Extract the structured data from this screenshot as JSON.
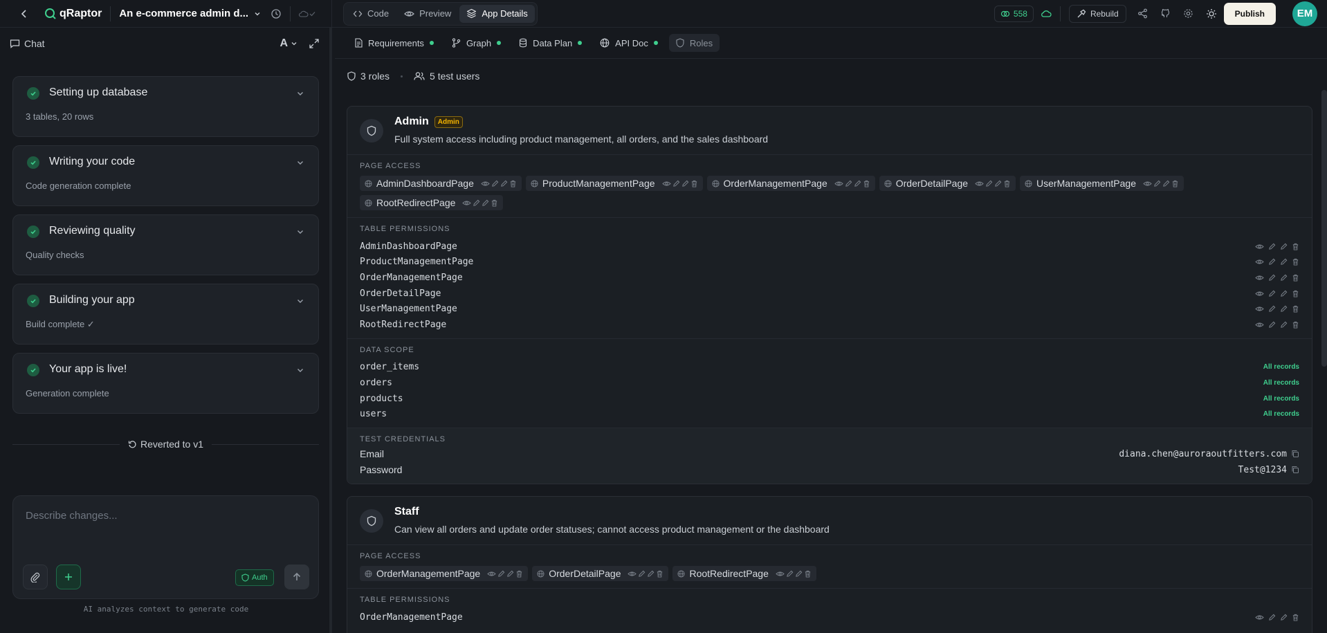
{
  "app": {
    "brand": "qRaptor",
    "project_title": "An e-commerce admin d..."
  },
  "view_tabs": [
    {
      "label": "Code",
      "icon": "code-icon"
    },
    {
      "label": "Preview",
      "icon": "eye-icon"
    },
    {
      "label": "App Details",
      "icon": "layers-icon",
      "active": true
    }
  ],
  "toolbar": {
    "credits": "558",
    "rebuild_label": "Rebuild",
    "publish_label": "Publish",
    "avatar_initials": "EM"
  },
  "chat": {
    "header_label": "Chat",
    "font_label": "A",
    "steps": [
      {
        "title": "Setting up database",
        "subtitle": "3 tables, 20 rows"
      },
      {
        "title": "Writing your code",
        "subtitle": "Code generation complete"
      },
      {
        "title": "Reviewing quality",
        "subtitle": "Quality checks"
      },
      {
        "title": "Building your app",
        "subtitle": "Build complete ✓"
      },
      {
        "title": "Your app is live!",
        "subtitle": "Generation complete"
      }
    ],
    "reverted_label": "Reverted to v1",
    "composer_placeholder": "Describe changes...",
    "auth_label": "Auth",
    "footnote": "AI analyzes context to generate code"
  },
  "details_tabs": [
    {
      "label": "Requirements",
      "icon": "file-icon",
      "dot": true
    },
    {
      "label": "Graph",
      "icon": "branch-icon",
      "dot": true
    },
    {
      "label": "Data Plan",
      "icon": "database-icon",
      "dot": true
    },
    {
      "label": "API Doc",
      "icon": "globe-icon",
      "dot": true
    },
    {
      "label": "Roles",
      "icon": "shield-icon",
      "dot": false,
      "active": true
    }
  ],
  "summary": {
    "roles": "3 roles",
    "users": "5 test users"
  },
  "labels": {
    "page_access": "PAGE ACCESS",
    "table_permissions": "TABLE PERMISSIONS",
    "data_scope": "DATA SCOPE",
    "test_credentials": "TEST CREDENTIALS",
    "email": "Email",
    "password": "Password"
  },
  "roles": [
    {
      "name": "Admin",
      "badge": "Admin",
      "description": "Full system access including product management, all orders, and the sales dashboard",
      "page_access": [
        "AdminDashboardPage",
        "ProductManagementPage",
        "OrderManagementPage",
        "OrderDetailPage",
        "UserManagementPage",
        "RootRedirectPage"
      ],
      "table_permissions": [
        "AdminDashboardPage",
        "ProductManagementPage",
        "OrderManagementPage",
        "OrderDetailPage",
        "UserManagementPage",
        "RootRedirectPage"
      ],
      "data_scope": [
        {
          "table": "order_items",
          "scope": "All records"
        },
        {
          "table": "orders",
          "scope": "All records"
        },
        {
          "table": "products",
          "scope": "All records"
        },
        {
          "table": "users",
          "scope": "All records"
        }
      ],
      "credentials": {
        "email": "diana.chen@auroraoutfitters.com",
        "password": "Test@1234"
      }
    },
    {
      "name": "Staff",
      "description": "Can view all orders and update order statuses; cannot access product management or the dashboard",
      "page_access": [
        "OrderManagementPage",
        "OrderDetailPage",
        "RootRedirectPage"
      ],
      "table_permissions": [
        "OrderManagementPage"
      ]
    }
  ]
}
